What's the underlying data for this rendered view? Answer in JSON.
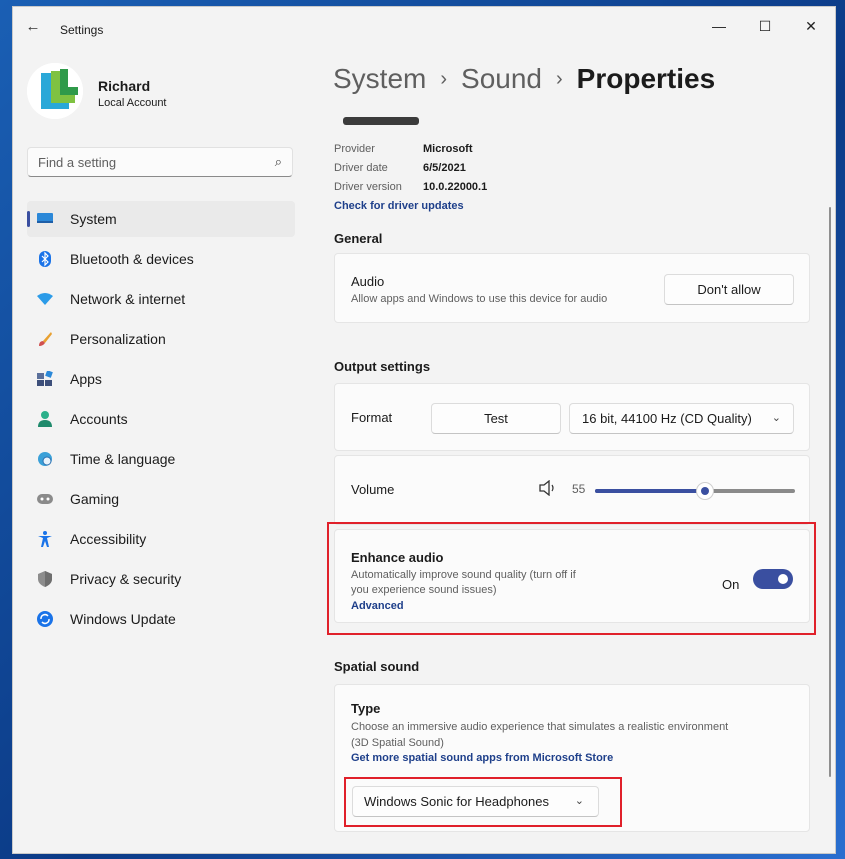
{
  "window": {
    "title": "Settings",
    "back_icon": "arrow-left-icon",
    "minimize_glyph": "—",
    "maximize_glyph": "☐",
    "close_glyph": "✕"
  },
  "profile": {
    "name": "Richard",
    "account_type": "Local Account"
  },
  "search": {
    "placeholder": "Find a setting",
    "icon": "search-icon"
  },
  "sidebar": {
    "items": [
      {
        "label": "System",
        "icon": "monitor-icon",
        "active": true
      },
      {
        "label": "Bluetooth & devices",
        "icon": "bluetooth-icon"
      },
      {
        "label": "Network & internet",
        "icon": "wifi-icon"
      },
      {
        "label": "Personalization",
        "icon": "brush-icon"
      },
      {
        "label": "Apps",
        "icon": "apps-icon"
      },
      {
        "label": "Accounts",
        "icon": "person-icon"
      },
      {
        "label": "Time & language",
        "icon": "globe-clock-icon"
      },
      {
        "label": "Gaming",
        "icon": "gamepad-icon"
      },
      {
        "label": "Accessibility",
        "icon": "accessibility-icon"
      },
      {
        "label": "Privacy & security",
        "icon": "shield-icon"
      },
      {
        "label": "Windows Update",
        "icon": "update-icon"
      }
    ]
  },
  "breadcrumb": {
    "items": [
      "System",
      "Sound"
    ],
    "current": "Properties",
    "separator": "›"
  },
  "driver": {
    "provider_label": "Provider",
    "provider_value": "Microsoft",
    "date_label": "Driver date",
    "date_value": "6/5/2021",
    "version_label": "Driver version",
    "version_value": "10.0.22000.1",
    "update_link": "Check for driver updates"
  },
  "general": {
    "heading": "General",
    "audio": {
      "title": "Audio",
      "description": "Allow apps and Windows to use this device for audio",
      "button": "Don't allow"
    }
  },
  "output": {
    "heading": "Output settings",
    "format": {
      "label": "Format",
      "test_button": "Test",
      "selected": "16 bit, 44100 Hz (CD Quality)"
    },
    "volume": {
      "label": "Volume",
      "value": "55",
      "level": 0.55
    },
    "enhance": {
      "title": "Enhance audio",
      "description_line1": "Automatically improve sound quality (turn off if",
      "description_line2": "you experience sound issues)",
      "advanced_link": "Advanced",
      "state_label": "On"
    }
  },
  "spatial": {
    "heading": "Spatial sound",
    "type_title": "Type",
    "description_line1": "Choose an immersive audio experience that simulates a realistic environment",
    "description_line2": "(3D Spatial Sound)",
    "store_link": "Get more spatial sound apps from Microsoft Store",
    "selected": "Windows Sonic for Headphones"
  },
  "colors": {
    "accent": "#3a4fa0",
    "highlight": "#e0202a",
    "link": "#1e3f8a"
  }
}
